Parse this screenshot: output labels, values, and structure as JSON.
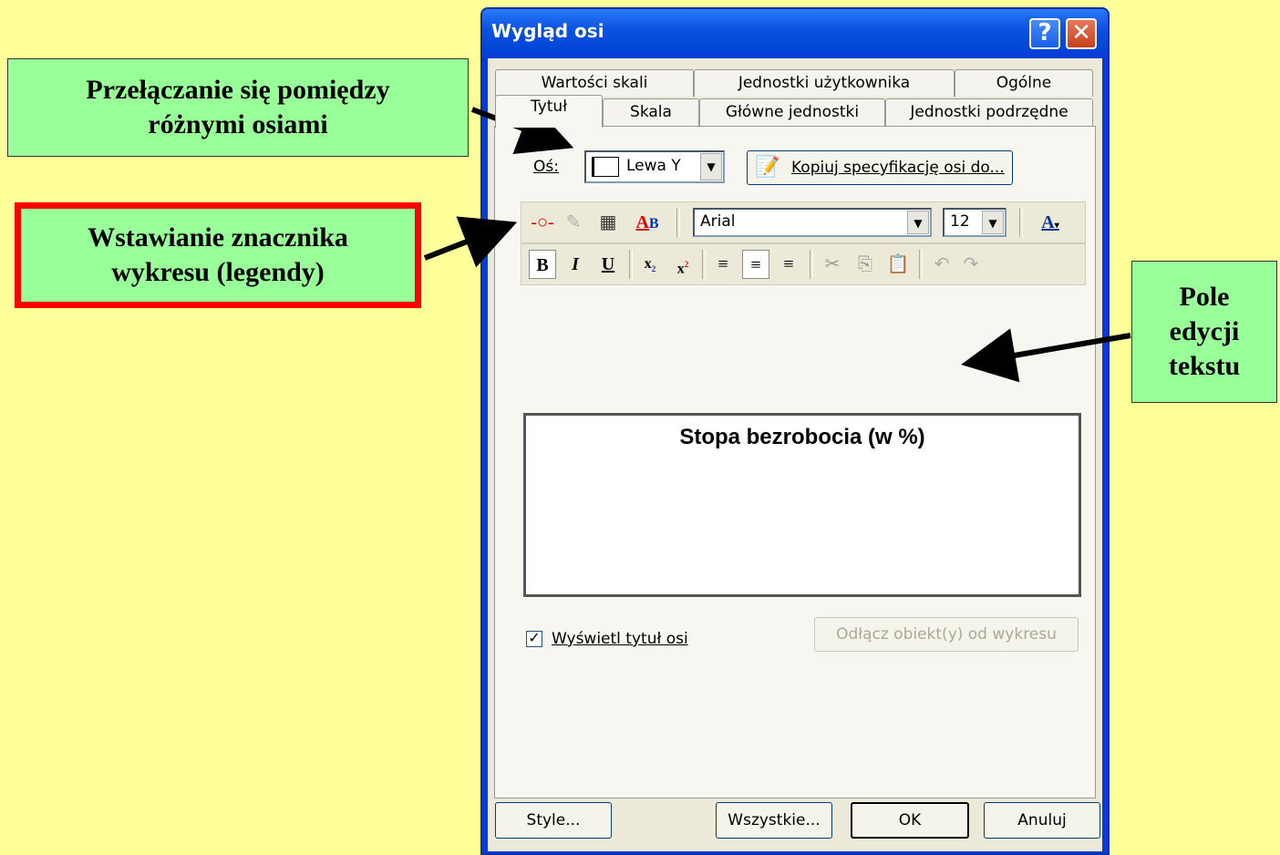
{
  "dialog": {
    "title": "Wygląd osi",
    "help_glyph": "?",
    "close_glyph": "✕"
  },
  "tabs": {
    "row_back": [
      "Wartości skali",
      "Jednostki użytkownika",
      "Ogólne"
    ],
    "row_front": [
      "Tytuł",
      "Skala",
      "Główne jednostki",
      "Jednostki podrzędne"
    ],
    "selected": "Tytuł"
  },
  "axis": {
    "label": "Oś:",
    "value": "Lewa Y",
    "copy_button": "Kopiuj specyfikację osi do..."
  },
  "format": {
    "font": "Arial",
    "size": "12"
  },
  "toolbar_row1_icons": [
    "insert-legend-marker-icon",
    "insert-symbol-icon",
    "insert-table-icon",
    "text-style-icon",
    "font-color-icon"
  ],
  "toolbar_row2": {
    "bold": "B",
    "italic": "I",
    "underline": "U",
    "icons": [
      "subscript-icon",
      "superscript-icon",
      "align-left-icon",
      "align-center-icon",
      "align-right-icon",
      "cut-icon",
      "copy-icon",
      "paste-icon",
      "undo-icon",
      "redo-icon"
    ]
  },
  "edit_text": "Stopa bezrobocia (w %)",
  "show_title": {
    "label": "Wyświetl tytuł osi",
    "checked": true
  },
  "detach_button": "Odłącz obiekt(y) od wykresu",
  "footer": {
    "style": "Style...",
    "all": "Wszystkie...",
    "ok": "OK",
    "cancel": "Anuluj"
  },
  "callouts": {
    "switch_axes": [
      "Przełączanie się pomiędzy",
      "różnymi osiami"
    ],
    "insert_marker": [
      "Wstawianie znacznika",
      "wykresu (legendy)"
    ],
    "edit_field": [
      "Pole",
      "edycji",
      "tekstu"
    ]
  },
  "colors": {
    "background": "#ffff99",
    "callout_fill": "#99ff99",
    "highlight_border": "#ff0000",
    "title_bar": "#0a52e0"
  }
}
